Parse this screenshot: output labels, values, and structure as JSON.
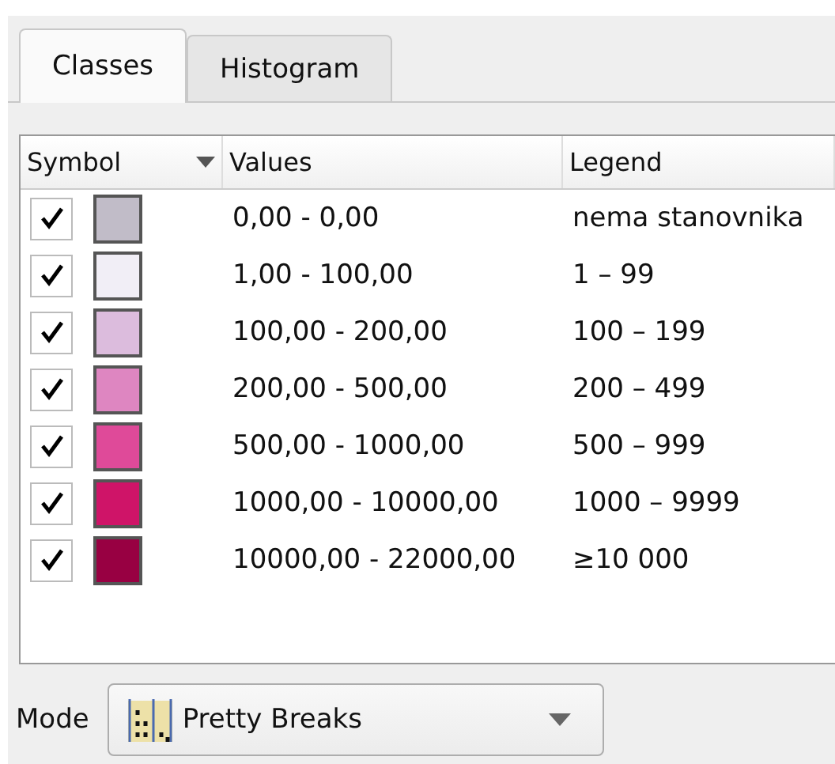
{
  "tabs": [
    {
      "label": "Classes",
      "selected": true
    },
    {
      "label": "Histogram",
      "selected": false
    }
  ],
  "table": {
    "columns": [
      "Symbol",
      "Values",
      "Legend"
    ],
    "rows": [
      {
        "checked": true,
        "color": "#c1bcc8",
        "values": "0,00 - 0,00",
        "legend": "nema stanovnika"
      },
      {
        "checked": true,
        "color": "#f1eef6",
        "values": "1,00 - 100,00",
        "legend": "1 – 99"
      },
      {
        "checked": true,
        "color": "#dcbcdd",
        "values": "100,00 - 200,00",
        "legend": "100 – 199"
      },
      {
        "checked": true,
        "color": "#de86c1",
        "values": "200,00 - 500,00",
        "legend": "200 – 499"
      },
      {
        "checked": true,
        "color": "#df4a99",
        "values": "500,00 - 1000,00",
        "legend": "500 – 999"
      },
      {
        "checked": true,
        "color": "#cf1468",
        "values": "1000,00 - 10000,00",
        "legend": "1000 – 9999"
      },
      {
        "checked": true,
        "color": "#980042",
        "values": "10000,00 - 22000,00",
        "legend": "≥10 000"
      }
    ]
  },
  "mode": {
    "label": "Mode",
    "value": "Pretty Breaks"
  }
}
